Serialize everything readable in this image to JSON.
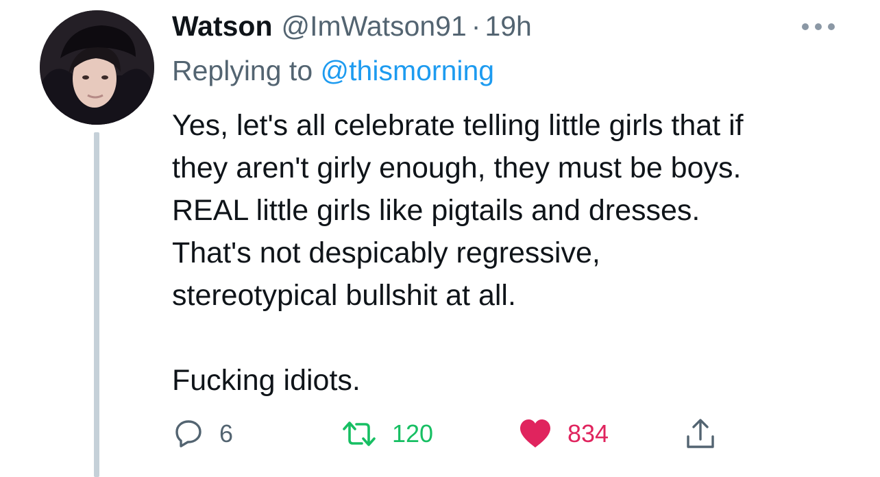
{
  "tweet": {
    "display_name": "Watson",
    "handle": "@ImWatson91",
    "separator": "·",
    "time": "19h",
    "replying_prefix": "Replying to",
    "replying_to": "@thismorning",
    "text": "Yes, let's all celebrate telling little girls that if\nthey aren't girly enough, they must be boys.\nREAL little girls like pigtails and dresses.\nThat's not despicably regressive,\nstereotypical bullshit at all.\n\nFucking idiots."
  },
  "actions": {
    "reply_count": "6",
    "retweet_count": "120",
    "like_count": "834"
  },
  "icons": {
    "more": "more-horizontal-icon",
    "reply": "reply-bubble-icon",
    "retweet": "retweet-icon",
    "like": "heart-icon",
    "share": "share-icon"
  },
  "colors": {
    "text_primary": "#0f1419",
    "text_secondary": "#536471",
    "link": "#1d9bf0",
    "retweet_active": "#17bf63",
    "like_active": "#e0245e",
    "thread_line": "#c5d0d8"
  }
}
